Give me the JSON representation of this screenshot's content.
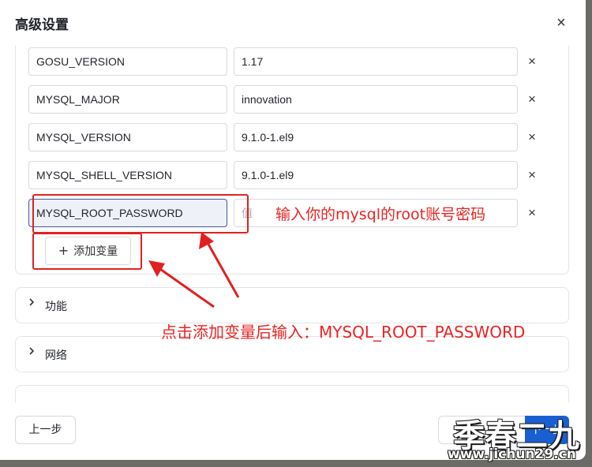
{
  "dialog": {
    "title": "高级设置",
    "close_icon": "×"
  },
  "env_vars": [
    {
      "key": "GOSU_VERSION",
      "value": "1.17"
    },
    {
      "key": "MYSQL_MAJOR",
      "value": "innovation"
    },
    {
      "key": "MYSQL_VERSION",
      "value": "9.1.0-1.el9"
    },
    {
      "key": "MYSQL_SHELL_VERSION",
      "value": "9.1.0-1.el9"
    },
    {
      "key": "MYSQL_ROOT_PASSWORD",
      "value": "",
      "value_placeholder": "值"
    }
  ],
  "row_delete_icon": "×",
  "add_variable": {
    "icon": "+",
    "label": "添加变量"
  },
  "sections": [
    {
      "label": "功能",
      "icon": "chevron-right"
    },
    {
      "label": "网络",
      "icon": "chevron-right"
    }
  ],
  "footer": {
    "prev_label": "上一步",
    "next_label": "下一步"
  },
  "annotations": {
    "password_hint": "输入你的mysql的root账号密码",
    "add_hint": "点击添加变量后输入：MYSQL_ROOT_PASSWORD",
    "color": "#e02121"
  },
  "watermark": {
    "text": "季春二九",
    "url": "www.jichun29.cn"
  },
  "colors": {
    "primary": "#1a5fd1",
    "focus_border": "#3d5a9f"
  }
}
